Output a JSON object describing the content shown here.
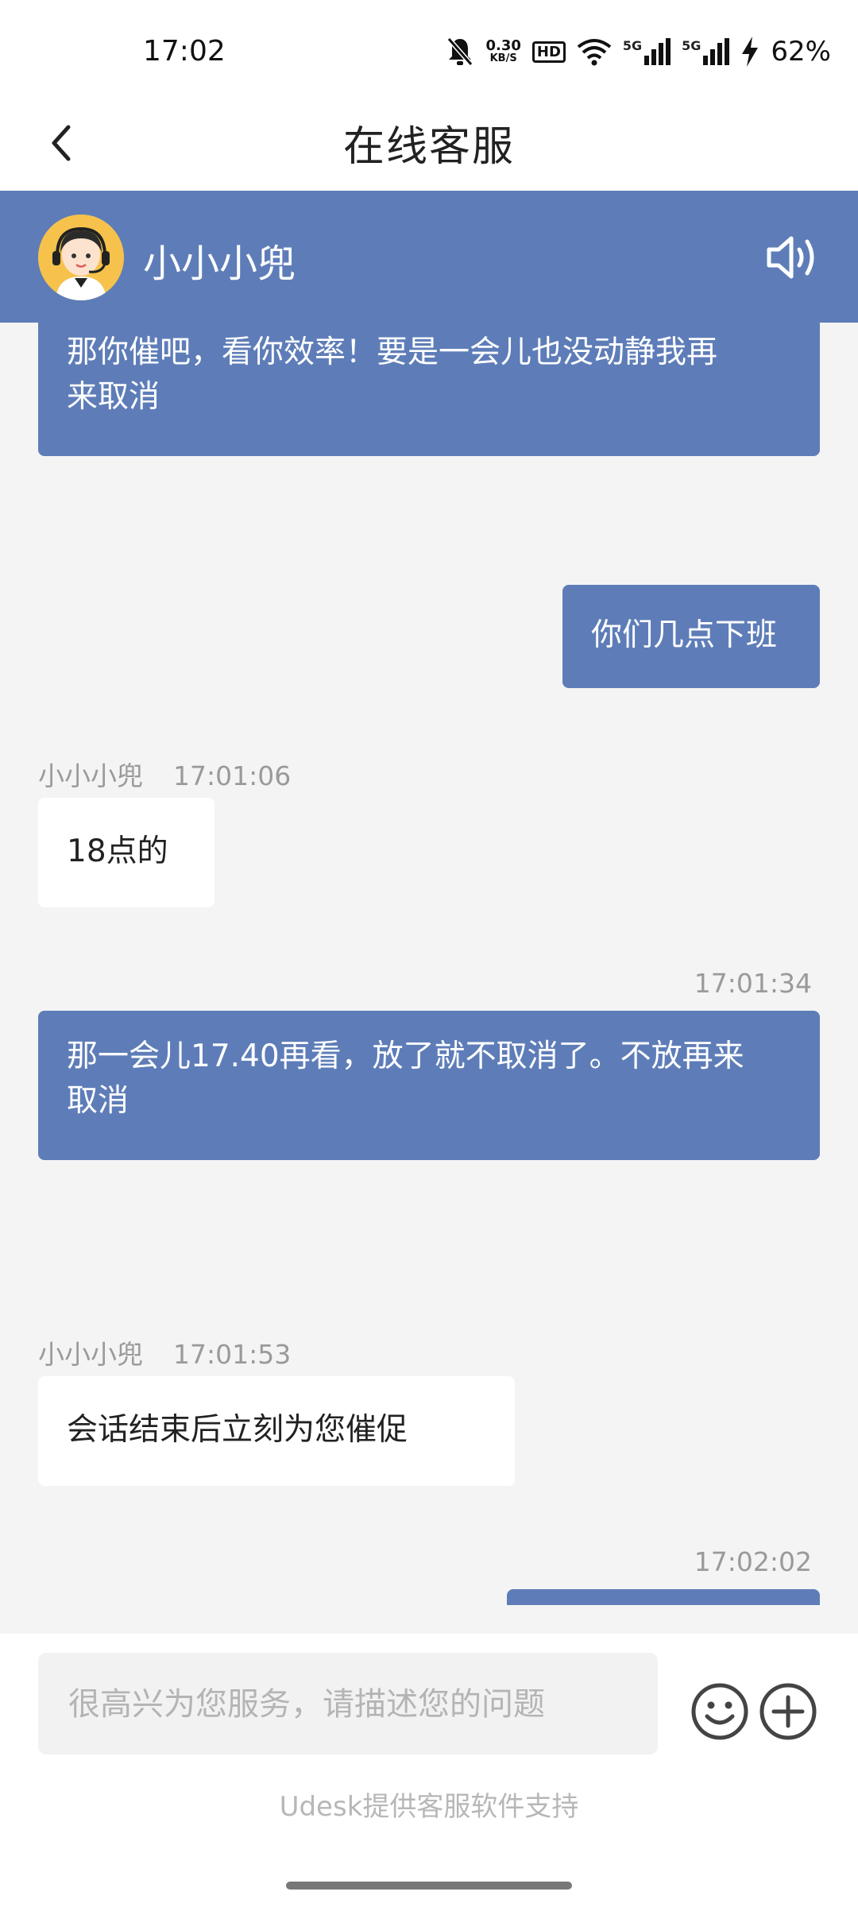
{
  "status_bar": {
    "time": "17:02",
    "speed_value": "0.30",
    "speed_unit": "KB/S",
    "hd": "HD",
    "net1": "5G",
    "net2": "5G",
    "battery": "62%"
  },
  "header": {
    "title": "在线客服"
  },
  "agent": {
    "name": "小小小兜"
  },
  "messages": [
    {
      "direction": "out",
      "text_line1": "那你催吧，看你效率！要是一会儿也没动静我再",
      "text_line2": "来取消"
    },
    {
      "direction": "out",
      "text": "你们几点下班"
    },
    {
      "direction": "in",
      "sender": "小小小兜",
      "time": "17:01:06",
      "text": "18点的"
    },
    {
      "direction": "out",
      "time": "17:01:34",
      "text_line1": "那一会儿17.40再看，放了就不取消了。不放再来",
      "text_line2": "取消"
    },
    {
      "direction": "in",
      "sender": "小小小兜",
      "time": "17:01:53",
      "text": "会话结束后立刻为您催促"
    },
    {
      "direction": "out",
      "time": "17:02:02",
      "text": ""
    }
  ],
  "input": {
    "placeholder": "很高兴为您服务，请描述您的问题",
    "value": ""
  },
  "footer": {
    "powered_by": "Udesk提供客服软件支持"
  },
  "colors": {
    "accent": "#5e7db8",
    "background": "#f4f4f4"
  },
  "icons": {
    "back": "chevron-left-icon",
    "speaker": "speaker-icon",
    "emoji": "emoji-icon",
    "add": "plus-circle-icon"
  }
}
